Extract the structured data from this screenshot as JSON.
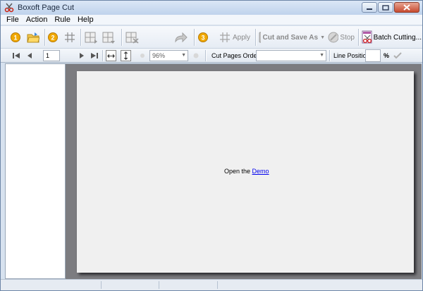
{
  "window": {
    "title": "Boxoft Page Cut"
  },
  "menu": {
    "items": [
      "File",
      "Action",
      "Rule",
      "Help"
    ]
  },
  "toolbar": {
    "step1_label": "1",
    "step2_label": "2",
    "step3_label": "3",
    "apply_label": "Apply",
    "cut_save_label": "Cut and Save As",
    "stop_label": "Stop",
    "batch_label": "Batch Cutting..."
  },
  "navbar": {
    "page_number": "1",
    "zoom": "96%",
    "cut_order_label": "Cut Pages Order:",
    "cut_order_value": "",
    "line_position_label": "Line Position:",
    "line_position_value": "",
    "percent": "%"
  },
  "document": {
    "open_prefix": "Open the",
    "demo_link": "Demo"
  },
  "colors": {
    "step_badge": "#f0a800",
    "accent": "#3a6ea5",
    "view_bg": "#7c7c80"
  }
}
